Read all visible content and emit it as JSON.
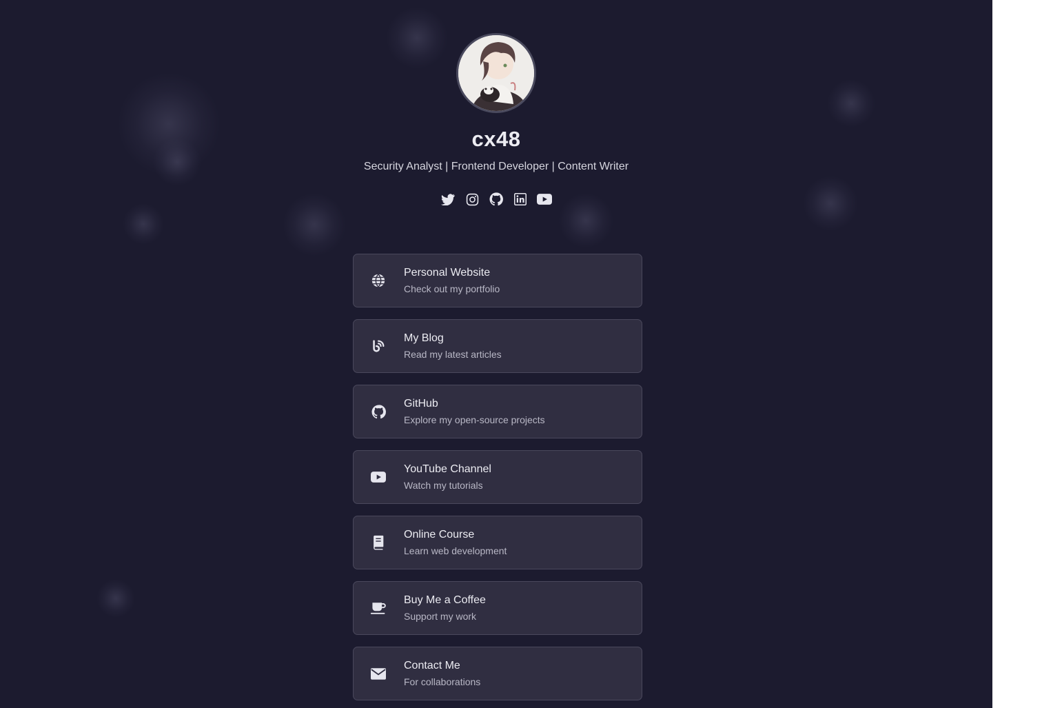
{
  "profile": {
    "name": "cx48",
    "tagline": "Security Analyst | Frontend Developer | Content Writer",
    "avatar_alt": "anime character with cat"
  },
  "socials": [
    {
      "icon": "twitter-icon"
    },
    {
      "icon": "instagram-icon"
    },
    {
      "icon": "github-icon"
    },
    {
      "icon": "linkedin-icon"
    },
    {
      "icon": "youtube-icon"
    }
  ],
  "links": [
    {
      "title": "Personal Website",
      "subtitle": "Check out my portfolio",
      "icon": "globe-icon"
    },
    {
      "title": "My Blog",
      "subtitle": "Read my latest articles",
      "icon": "blog-icon"
    },
    {
      "title": "GitHub",
      "subtitle": "Explore my open-source projects",
      "icon": "github-icon"
    },
    {
      "title": "YouTube Channel",
      "subtitle": "Watch my tutorials",
      "icon": "youtube-icon"
    },
    {
      "title": "Online Course",
      "subtitle": "Learn web development",
      "icon": "book-icon"
    },
    {
      "title": "Buy Me a Coffee",
      "subtitle": "Support my work",
      "icon": "coffee-icon"
    },
    {
      "title": "Contact Me",
      "subtitle": "For collaborations",
      "icon": "envelope-icon"
    }
  ],
  "colors": {
    "background": "#1c1b2f",
    "card": "#302e41",
    "card_border": "#4a485c",
    "text": "#ececf2",
    "muted": "#b9b8c6"
  }
}
